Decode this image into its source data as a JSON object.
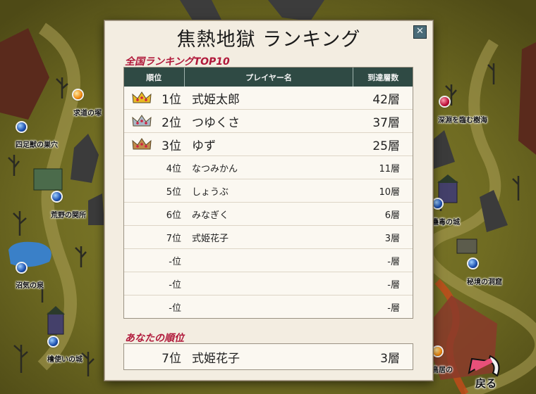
{
  "dialog": {
    "title": "焦熱地獄 ランキング",
    "close_icon": "close-icon",
    "national_label": "全国ランキングTOP10",
    "headers": {
      "rank": "順位",
      "player": "プレイヤー名",
      "floor": "到達層数"
    },
    "rows": [
      {
        "rank": "1位",
        "name": "式姫太郎",
        "floor": "42層",
        "crown": "gold"
      },
      {
        "rank": "2位",
        "name": "つゆくさ",
        "floor": "37層",
        "crown": "silver"
      },
      {
        "rank": "3位",
        "name": "ゆず",
        "floor": "25層",
        "crown": "bronze"
      },
      {
        "rank": "4位",
        "name": "なつみかん",
        "floor": "11層"
      },
      {
        "rank": "5位",
        "name": "しょうぶ",
        "floor": "10層"
      },
      {
        "rank": "6位",
        "name": "みなぎく",
        "floor": "6層"
      },
      {
        "rank": "7位",
        "name": "式姫花子",
        "floor": "3層"
      },
      {
        "rank": "-位",
        "name": "",
        "floor": "-層"
      },
      {
        "rank": "-位",
        "name": "",
        "floor": "-層"
      },
      {
        "rank": "-位",
        "name": "",
        "floor": "-層"
      }
    ],
    "mine_label": "あなたの順位",
    "mine": {
      "rank": "7位",
      "name": "式姫花子",
      "floor": "3層"
    }
  },
  "map": {
    "locations": [
      {
        "label": "求道の塚",
        "orb": "orange"
      },
      {
        "label": "四足獣の巣穴",
        "orb": "blue"
      },
      {
        "label": "荒野の関所",
        "orb": "blue"
      },
      {
        "label": "沼気の泉",
        "orb": "blue"
      },
      {
        "label": "檜使いの城",
        "orb": "blue"
      },
      {
        "label": "深淵を臨む樹海",
        "orb": "red"
      },
      {
        "label": "蠱毒の城",
        "orb": "blue"
      },
      {
        "label": "秘境の洞窟",
        "orb": "blue"
      },
      {
        "label": "鳥居の",
        "orb": "orange"
      }
    ],
    "return_label": "戻る"
  },
  "colors": {
    "header_bg": "#2f4a44",
    "section_label": "#b0183a",
    "panel_bg": "#f3ede1",
    "gold": "#e8b923",
    "silver": "#a8b6c4",
    "bronze": "#c08a4a"
  }
}
